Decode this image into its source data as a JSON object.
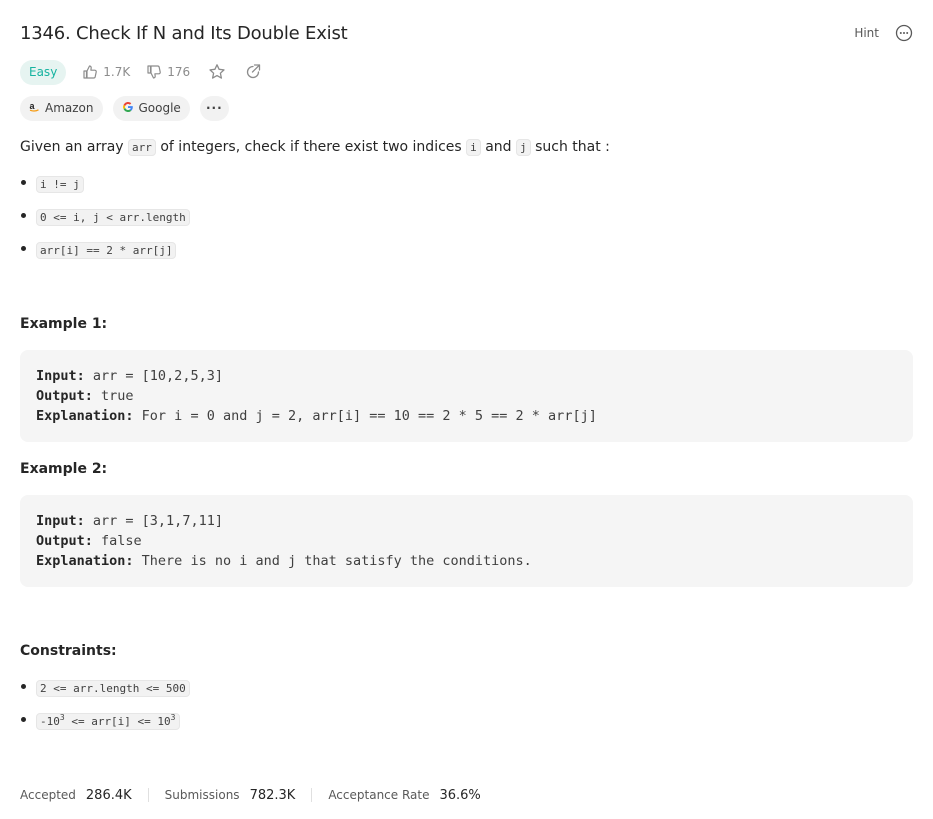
{
  "problem": {
    "title": "1346. Check If N and Its Double Exist",
    "hint_label": "Hint",
    "difficulty": "Easy",
    "likes": "1.7K",
    "dislikes": "176"
  },
  "tags": [
    {
      "label": "Amazon"
    },
    {
      "label": "Google"
    }
  ],
  "tags_more": "···",
  "description": {
    "p1": "Given an array ",
    "c1": "arr",
    "p2": " of integers, check if there exist two indices ",
    "c2": "i",
    "p3": " and ",
    "c3": "j",
    "p4": " such that :"
  },
  "conditions": [
    "i != j",
    "0 <= i, j < arr.length",
    "arr[i] == 2 * arr[j]"
  ],
  "examples": [
    {
      "heading": "Example 1:",
      "input_label": "Input:",
      "input": " arr = [10,2,5,3]",
      "output_label": "Output:",
      "output": " true",
      "explanation_label": "Explanation:",
      "explanation": " For i = 0 and j = 2, arr[i] == 10 == 2 * 5 == 2 * arr[j]"
    },
    {
      "heading": "Example 2:",
      "input_label": "Input:",
      "input": " arr = [3,1,7,11]",
      "output_label": "Output:",
      "output": " false",
      "explanation_label": "Explanation:",
      "explanation": " There is no i and j that satisfy the conditions."
    }
  ],
  "constraints": {
    "heading": "Constraints:",
    "c1": "2 <= arr.length <= 500",
    "c2_a": "-10",
    "c2_sup1": "3",
    "c2_b": " <= arr[i] <= 10",
    "c2_sup2": "3"
  },
  "stats": {
    "accepted_label": "Accepted",
    "accepted_value": "286.4K",
    "submissions_label": "Submissions",
    "submissions_value": "782.3K",
    "rate_label": "Acceptance Rate",
    "rate_value": "36.6%"
  },
  "colors": {
    "easy": "#15b3a0",
    "easy_bg": "#e6f4f1",
    "code_bg": "#f5f5f5"
  },
  "icons": [
    "thumbs-up-icon",
    "thumbs-down-icon",
    "star-icon",
    "share-icon",
    "more-icon",
    "amazon-logo",
    "google-logo"
  ]
}
